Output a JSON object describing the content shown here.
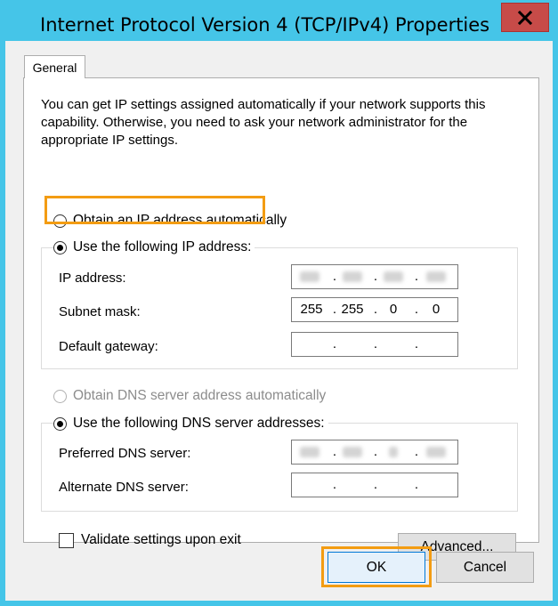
{
  "window": {
    "title": "Internet Protocol Version 4 (TCP/IPv4) Properties",
    "close_glyph": "✕"
  },
  "tabs": [
    {
      "label": "General",
      "selected": true
    }
  ],
  "general": {
    "intro_text": "You can get IP settings assigned automatically if your network supports this capability. Otherwise, you need to ask your network administrator for the appropriate IP settings.",
    "ip_mode": {
      "auto_label": "Obtain an IP address automatically",
      "manual_label": "Use the following IP address:",
      "selected": "manual"
    },
    "ip_fields": {
      "ip_address": {
        "label": "IP address:",
        "octets": [
          "",
          "",
          "",
          ""
        ],
        "redacted": true
      },
      "subnet_mask": {
        "label": "Subnet mask:",
        "octets": [
          "255",
          "255",
          "0",
          "0"
        ]
      },
      "default_gateway": {
        "label": "Default gateway:",
        "octets": [
          "",
          "",
          "",
          ""
        ]
      }
    },
    "dns_mode": {
      "auto_label": "Obtain DNS server address automatically",
      "auto_disabled": true,
      "manual_label": "Use the following DNS server addresses:",
      "selected": "manual"
    },
    "dns_fields": {
      "preferred": {
        "label": "Preferred DNS server:",
        "octets": [
          "",
          "",
          "",
          ""
        ],
        "redacted": true
      },
      "alternate": {
        "label": "Alternate DNS server:",
        "octets": [
          "",
          "",
          "",
          ""
        ]
      }
    },
    "validate_label": "Validate settings upon exit",
    "validate_checked": false,
    "advanced_label": "Advanced..."
  },
  "footer": {
    "ok_label": "OK",
    "cancel_label": "Cancel"
  },
  "colors": {
    "titlebar": "#45c5e8",
    "close_button": "#c74b48",
    "highlight": "#f39c12"
  }
}
